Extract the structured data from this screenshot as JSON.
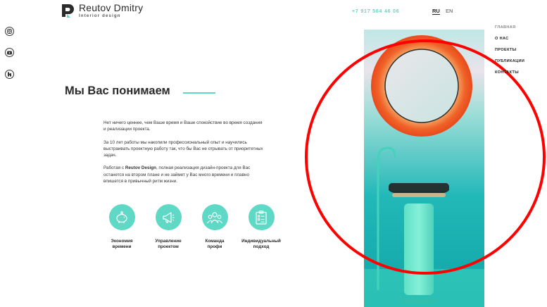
{
  "header": {
    "brand_name": "Reutov Dmitry",
    "brand_sub": "Interior design",
    "phone": "+7 917 564 46 06",
    "lang_active": "RU",
    "lang_other": "EN"
  },
  "nav": {
    "items": [
      "ГЛАВНАЯ",
      "О НАС",
      "ПРОЕКТЫ",
      "ПУБЛИКАЦИИ",
      "КОНТАКТЫ"
    ]
  },
  "social": [
    "instagram-icon",
    "youtube-icon",
    "houzz-icon"
  ],
  "main": {
    "title": "Мы Вас понимаем",
    "para1": "Нет ничего ценнее, чем Ваше время и Ваше спокойствие во время создания и реализации проекта.",
    "para2": "За 10 лет работы мы накопили профессиональный опыт и научились выстраивать проектную работу так, что бы Вас не отрывать от приоритетных задач.",
    "para3_pre": "Работая с ",
    "para3_bold": "Reutov Design",
    "para3_post": ", полная реализация дизайн-проекта для Вас останется на втором плане и не займет у Вас много времени и плавно впишется в привычный ритм жизни."
  },
  "features": [
    {
      "line1": "Экономия",
      "line2": "времени",
      "icon": "piggy-bank-icon"
    },
    {
      "line1": "Управление",
      "line2": "проектом",
      "icon": "megaphone-icon"
    },
    {
      "line1": "Команда",
      "line2": "профи",
      "icon": "team-icon"
    },
    {
      "line1": "Индивидуальный",
      "line2": "подход",
      "icon": "checklist-icon"
    }
  ],
  "colors": {
    "accent": "#5fd8c5",
    "annotation": "#ff0000",
    "mirror_frame": "#f0662a"
  }
}
